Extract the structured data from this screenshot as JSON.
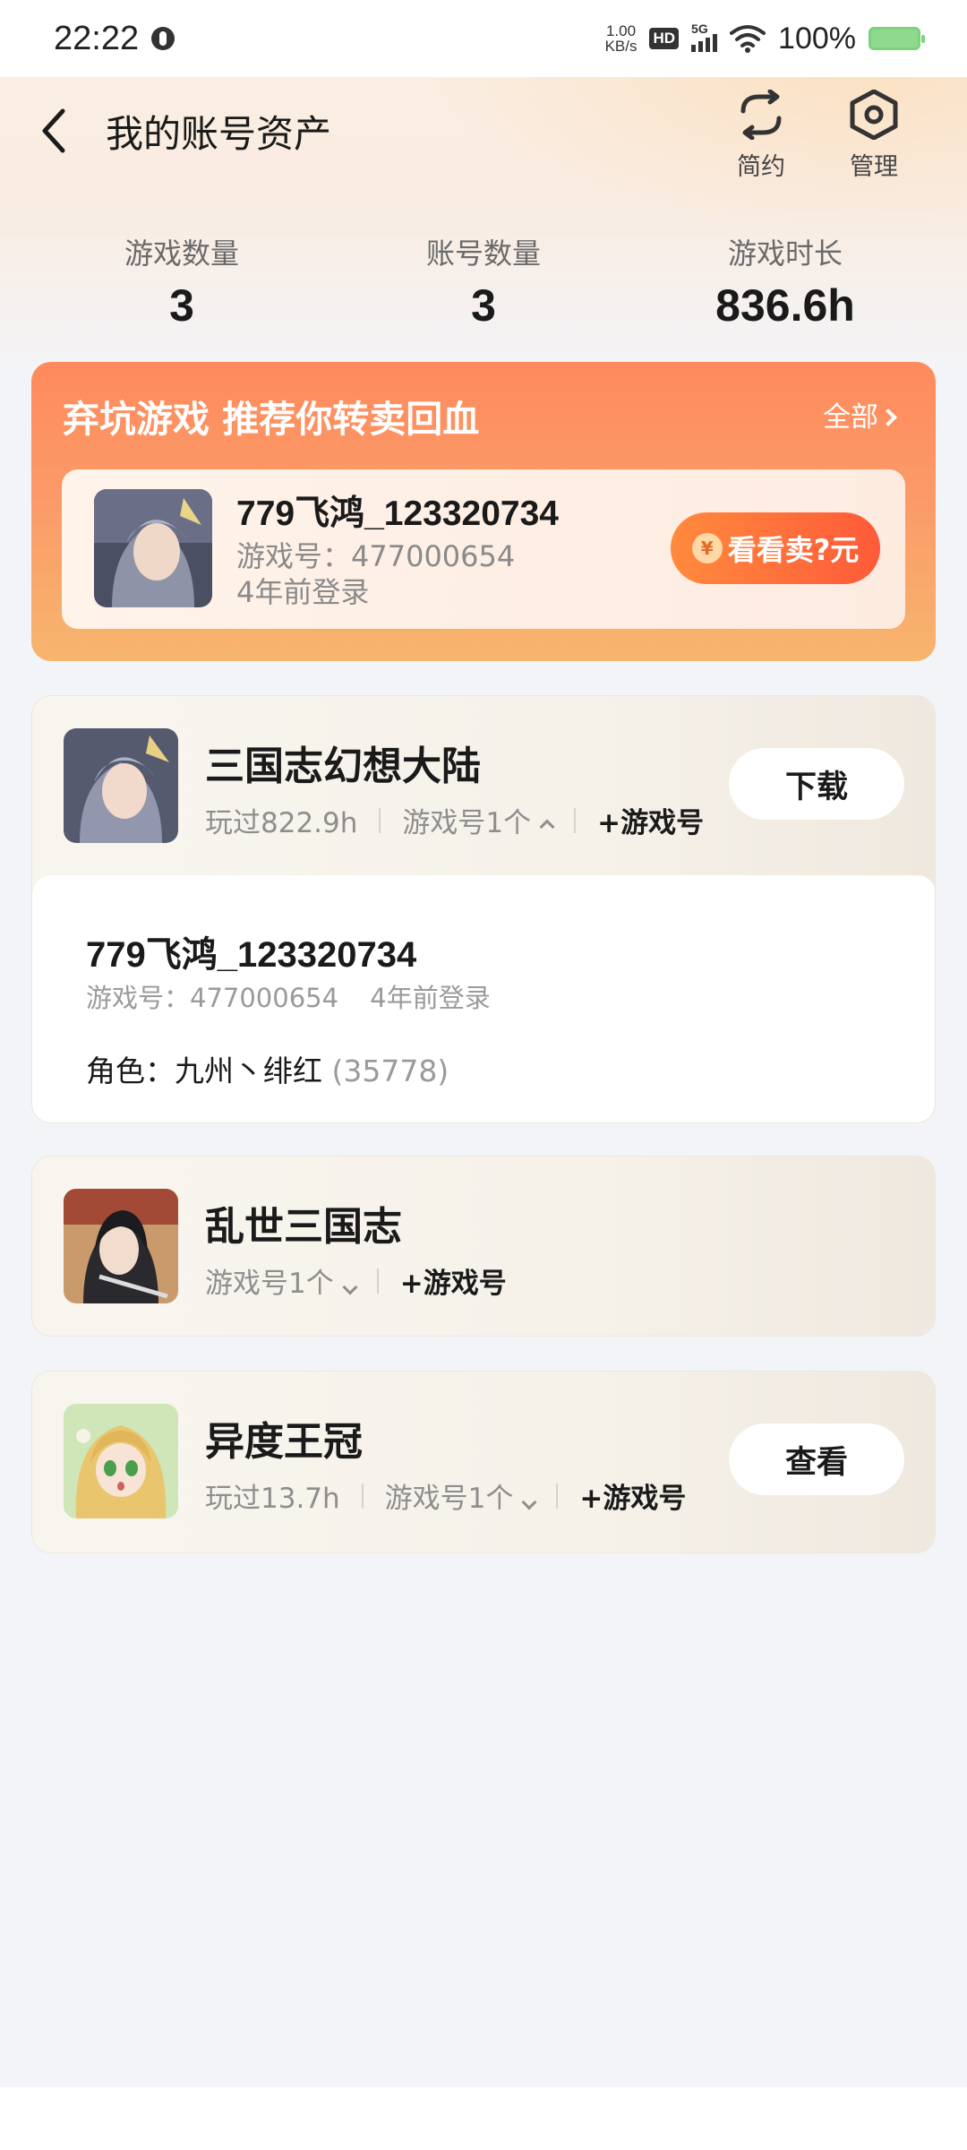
{
  "status_bar": {
    "time": "22:22",
    "net_speed_value": "1.00",
    "net_speed_unit": "KB/s",
    "hd": "HD",
    "network": "5G",
    "battery": "100%"
  },
  "header": {
    "title": "我的账号资产",
    "action_simple": "简约",
    "action_manage": "管理"
  },
  "stats": [
    {
      "label": "游戏数量",
      "value": "3"
    },
    {
      "label": "账号数量",
      "value": "3"
    },
    {
      "label": "游戏时长",
      "value": "836.6h"
    }
  ],
  "promo": {
    "title": "弃坑游戏 推荐你转卖回血",
    "all_label": "全部",
    "account_name": "779飞鸿_123320734",
    "game_id": "游戏号：477000654",
    "last_login": "4年前登录",
    "sell_button": "看看卖?元",
    "coin_symbol": "¥"
  },
  "games": [
    {
      "title": "三国志幻想大陆",
      "played": "玩过822.9h",
      "account_count": "游戏号1个",
      "add_account": "+游戏号",
      "action": "下载",
      "expanded": true,
      "account": {
        "name": "779飞鸿_123320734",
        "game_id": "游戏号：477000654",
        "last_login": "4年前登录",
        "role_label": "角色：九州丶绯红",
        "role_extra": "(35778)"
      }
    },
    {
      "title": "乱世三国志",
      "account_count": "游戏号1个",
      "add_account": "+游戏号",
      "expanded": false
    },
    {
      "title": "异度王冠",
      "played": "玩过13.7h",
      "account_count": "游戏号1个",
      "add_account": "+游戏号",
      "action": "查看",
      "expanded": false
    }
  ],
  "colors": {
    "promo_top": "#ff8a5c",
    "promo_bottom": "#f7b56e",
    "sell_button": "#ff5a3a",
    "page_bg": "#f3f4f8"
  }
}
